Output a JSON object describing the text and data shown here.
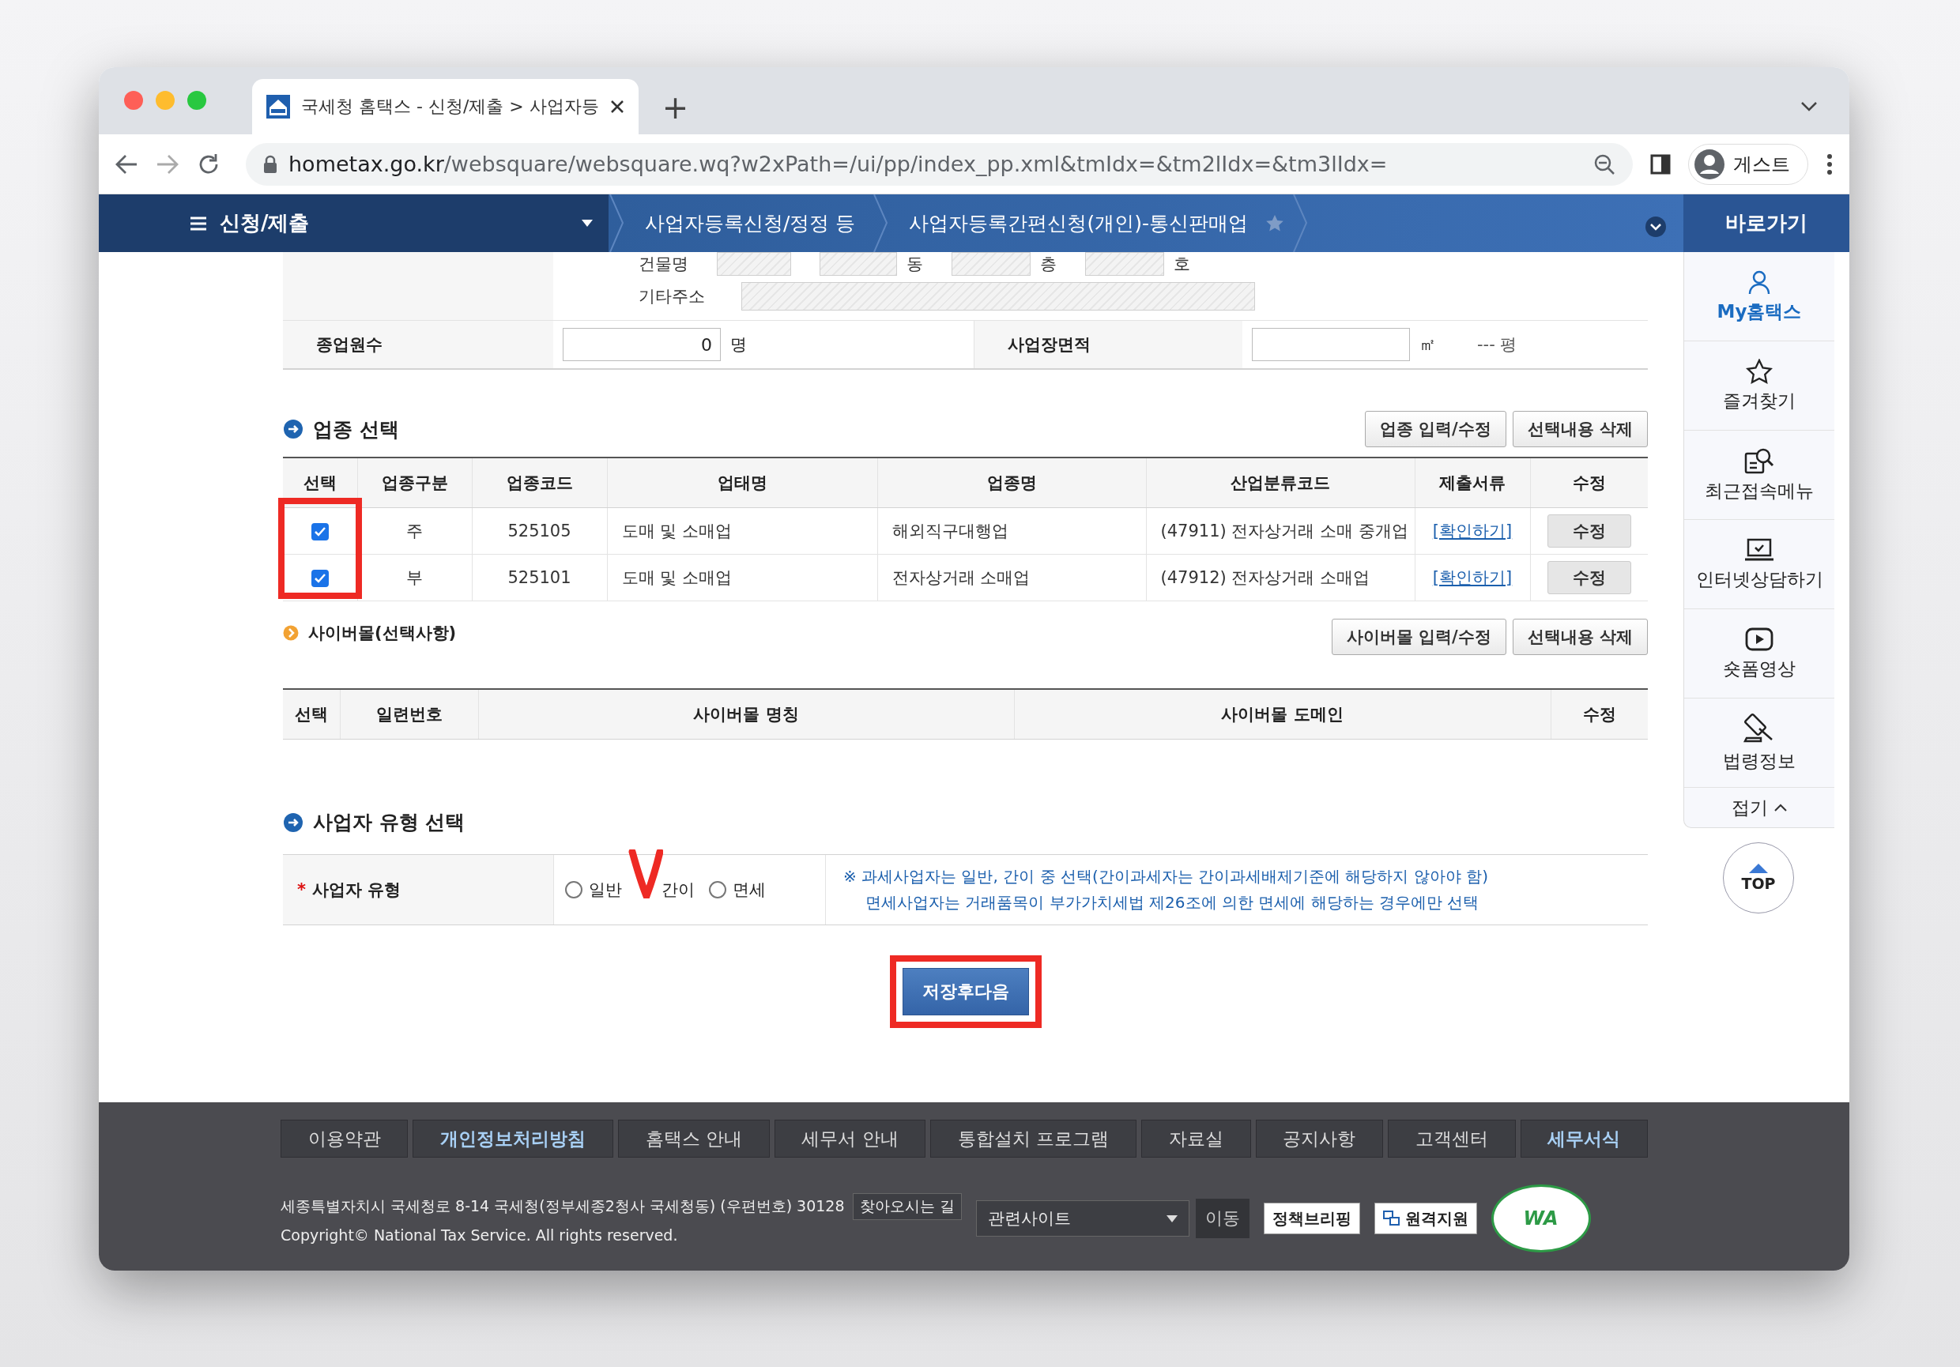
{
  "browser": {
    "tab_title": "국세청 홈택스 - 신청/제출 > 사업자등",
    "new_tab": "+",
    "url_host": "hometax.go.kr",
    "url_path": "/websquare/websquare.wq?w2xPath=/ui/pp/index_pp.xml&tmIdx=&tm2lIdx=&tm3lIdx=",
    "profile": "게스트"
  },
  "nav": {
    "menu": "신청/제출",
    "breadcrumbs": [
      "사업자등록신청/정정 등",
      "사업자등록간편신청(개인)-통신판매업"
    ],
    "quick_title": "바로가기"
  },
  "address": {
    "building_labels": [
      "건물명",
      "동",
      "층",
      "호"
    ],
    "other_label": "기타주소"
  },
  "workplace": {
    "employees_label": "종업원수",
    "employees_value": "0",
    "employees_unit": "명",
    "area_label": "사업장면적",
    "area_unit": "㎡",
    "pyeong": "--- 평"
  },
  "industry": {
    "title": "업종 선택",
    "buttons": [
      "업종 입력/수정",
      "선택내용 삭제"
    ],
    "highlighted": true,
    "columns": [
      "선택",
      "업종구분",
      "업종코드",
      "업태명",
      "업종명",
      "산업분류코드",
      "제출서류",
      "수정"
    ],
    "rows": [
      {
        "checked": true,
        "type": "주",
        "code": "525105",
        "business": "도매 및 소매업",
        "item": "해외직구대행업",
        "class_code": "(47911) 전자상거래 소매 중개업",
        "document": "[확인하기]",
        "edit": "수정"
      },
      {
        "checked": true,
        "type": "부",
        "code": "525101",
        "business": "도매 및 소매업",
        "item": "전자상거래 소매업",
        "class_code": "(47912) 전자상거래 소매업",
        "document": "[확인하기]",
        "edit": "수정"
      }
    ]
  },
  "cybermall": {
    "title": "사이버몰(선택사항)",
    "buttons": [
      "사이버몰 입력/수정",
      "선택내용 삭제"
    ],
    "columns": [
      "선택",
      "일련번호",
      "사이버몰 명칭",
      "사이버몰 도메인",
      "수정"
    ]
  },
  "business_type": {
    "title": "사업자 유형 선택",
    "required": "*",
    "label": "사업자 유형",
    "options": [
      {
        "label": "일반",
        "selected": false,
        "marked": false
      },
      {
        "label": "간이",
        "selected": false,
        "marked": true
      },
      {
        "label": "면세",
        "selected": false,
        "marked": false
      }
    ],
    "notes": [
      "※ 과세사업자는 일반, 간이 중 선택(간이과세자는 간이과세배제기준에 해당하지 않아야 함)",
      "면세사업자는 거래품목이 부가가치세법 제26조에 의한 면세에 해당하는 경우에만 선택"
    ]
  },
  "save_button": {
    "label": "저장후다음",
    "highlighted": true
  },
  "sidebar": {
    "items": [
      {
        "label": "My홈택스",
        "kind": "person",
        "selected": true
      },
      {
        "label": "즐겨찾기",
        "kind": "star",
        "selected": false
      },
      {
        "label": "최근접속메뉴",
        "kind": "search",
        "selected": false
      },
      {
        "label": "인터넷상담하기",
        "kind": "laptop",
        "selected": false
      },
      {
        "label": "숏폼영상",
        "kind": "play",
        "selected": false
      },
      {
        "label": "법령정보",
        "kind": "gavel",
        "selected": false
      }
    ],
    "fold": "접기",
    "top": "TOP"
  },
  "footer": {
    "links": [
      {
        "label": "이용약관",
        "emphasis": false
      },
      {
        "label": "개인정보처리방침",
        "emphasis": true
      },
      {
        "label": "홈택스 안내",
        "emphasis": false
      },
      {
        "label": "세무서 안내",
        "emphasis": false
      },
      {
        "label": "통합설치 프로그램",
        "emphasis": false
      },
      {
        "label": "자료실",
        "emphasis": false
      },
      {
        "label": "공지사항",
        "emphasis": false
      },
      {
        "label": "고객센터",
        "emphasis": false
      },
      {
        "label": "세무서식",
        "emphasis": true
      }
    ],
    "address": "세종특별자치시 국세청로 8-14 국세청(정부세종2청사 국세청동) (우편번호) 30128",
    "directions": "찾아오시는 길",
    "copyright": "Copyright© National Tax Service. All rights reserved.",
    "related_select": "관련사이트",
    "go": "이동",
    "briefing": "정책브리핑",
    "remote": "원격지원",
    "wa_mark": "WA"
  }
}
